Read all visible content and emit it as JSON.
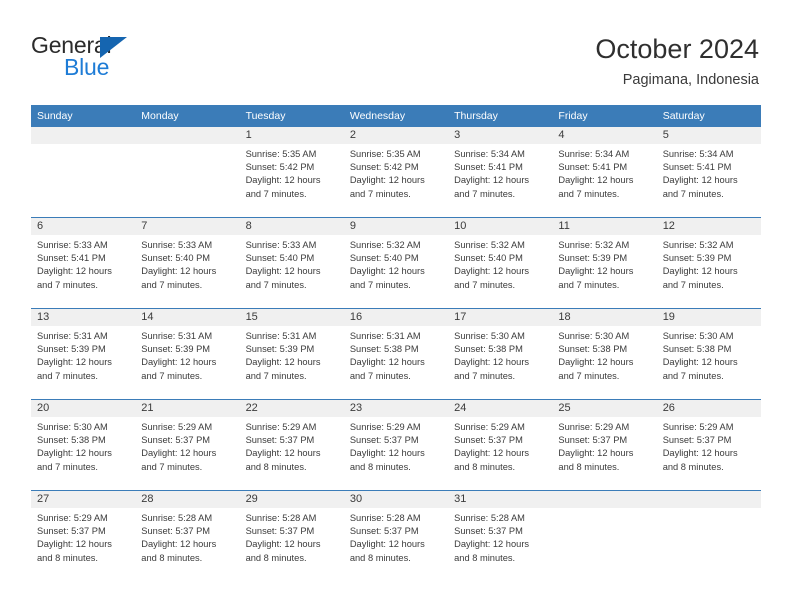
{
  "brand": {
    "name_top": "General",
    "name_bottom": "Blue",
    "triangle_color": "#1565b0",
    "blue_color": "#1e7cd6"
  },
  "header": {
    "title": "October 2024",
    "subtitle": "Pagimana, Indonesia"
  },
  "theme": {
    "header_bar": "#3b7cb8",
    "date_strip": "#f0f0f0",
    "text": "#3b3b3b"
  },
  "weekday_headers": [
    "Sunday",
    "Monday",
    "Tuesday",
    "Wednesday",
    "Thursday",
    "Friday",
    "Saturday"
  ],
  "weeks": [
    [
      {
        "day": "",
        "sunrise": "",
        "sunset": "",
        "daylight": ""
      },
      {
        "day": "",
        "sunrise": "",
        "sunset": "",
        "daylight": ""
      },
      {
        "day": "1",
        "sunrise": "Sunrise: 5:35 AM",
        "sunset": "Sunset: 5:42 PM",
        "daylight": "Daylight: 12 hours and 7 minutes."
      },
      {
        "day": "2",
        "sunrise": "Sunrise: 5:35 AM",
        "sunset": "Sunset: 5:42 PM",
        "daylight": "Daylight: 12 hours and 7 minutes."
      },
      {
        "day": "3",
        "sunrise": "Sunrise: 5:34 AM",
        "sunset": "Sunset: 5:41 PM",
        "daylight": "Daylight: 12 hours and 7 minutes."
      },
      {
        "day": "4",
        "sunrise": "Sunrise: 5:34 AM",
        "sunset": "Sunset: 5:41 PM",
        "daylight": "Daylight: 12 hours and 7 minutes."
      },
      {
        "day": "5",
        "sunrise": "Sunrise: 5:34 AM",
        "sunset": "Sunset: 5:41 PM",
        "daylight": "Daylight: 12 hours and 7 minutes."
      }
    ],
    [
      {
        "day": "6",
        "sunrise": "Sunrise: 5:33 AM",
        "sunset": "Sunset: 5:41 PM",
        "daylight": "Daylight: 12 hours and 7 minutes."
      },
      {
        "day": "7",
        "sunrise": "Sunrise: 5:33 AM",
        "sunset": "Sunset: 5:40 PM",
        "daylight": "Daylight: 12 hours and 7 minutes."
      },
      {
        "day": "8",
        "sunrise": "Sunrise: 5:33 AM",
        "sunset": "Sunset: 5:40 PM",
        "daylight": "Daylight: 12 hours and 7 minutes."
      },
      {
        "day": "9",
        "sunrise": "Sunrise: 5:32 AM",
        "sunset": "Sunset: 5:40 PM",
        "daylight": "Daylight: 12 hours and 7 minutes."
      },
      {
        "day": "10",
        "sunrise": "Sunrise: 5:32 AM",
        "sunset": "Sunset: 5:40 PM",
        "daylight": "Daylight: 12 hours and 7 minutes."
      },
      {
        "day": "11",
        "sunrise": "Sunrise: 5:32 AM",
        "sunset": "Sunset: 5:39 PM",
        "daylight": "Daylight: 12 hours and 7 minutes."
      },
      {
        "day": "12",
        "sunrise": "Sunrise: 5:32 AM",
        "sunset": "Sunset: 5:39 PM",
        "daylight": "Daylight: 12 hours and 7 minutes."
      }
    ],
    [
      {
        "day": "13",
        "sunrise": "Sunrise: 5:31 AM",
        "sunset": "Sunset: 5:39 PM",
        "daylight": "Daylight: 12 hours and 7 minutes."
      },
      {
        "day": "14",
        "sunrise": "Sunrise: 5:31 AM",
        "sunset": "Sunset: 5:39 PM",
        "daylight": "Daylight: 12 hours and 7 minutes."
      },
      {
        "day": "15",
        "sunrise": "Sunrise: 5:31 AM",
        "sunset": "Sunset: 5:39 PM",
        "daylight": "Daylight: 12 hours and 7 minutes."
      },
      {
        "day": "16",
        "sunrise": "Sunrise: 5:31 AM",
        "sunset": "Sunset: 5:38 PM",
        "daylight": "Daylight: 12 hours and 7 minutes."
      },
      {
        "day": "17",
        "sunrise": "Sunrise: 5:30 AM",
        "sunset": "Sunset: 5:38 PM",
        "daylight": "Daylight: 12 hours and 7 minutes."
      },
      {
        "day": "18",
        "sunrise": "Sunrise: 5:30 AM",
        "sunset": "Sunset: 5:38 PM",
        "daylight": "Daylight: 12 hours and 7 minutes."
      },
      {
        "day": "19",
        "sunrise": "Sunrise: 5:30 AM",
        "sunset": "Sunset: 5:38 PM",
        "daylight": "Daylight: 12 hours and 7 minutes."
      }
    ],
    [
      {
        "day": "20",
        "sunrise": "Sunrise: 5:30 AM",
        "sunset": "Sunset: 5:38 PM",
        "daylight": "Daylight: 12 hours and 7 minutes."
      },
      {
        "day": "21",
        "sunrise": "Sunrise: 5:29 AM",
        "sunset": "Sunset: 5:37 PM",
        "daylight": "Daylight: 12 hours and 7 minutes."
      },
      {
        "day": "22",
        "sunrise": "Sunrise: 5:29 AM",
        "sunset": "Sunset: 5:37 PM",
        "daylight": "Daylight: 12 hours and 8 minutes."
      },
      {
        "day": "23",
        "sunrise": "Sunrise: 5:29 AM",
        "sunset": "Sunset: 5:37 PM",
        "daylight": "Daylight: 12 hours and 8 minutes."
      },
      {
        "day": "24",
        "sunrise": "Sunrise: 5:29 AM",
        "sunset": "Sunset: 5:37 PM",
        "daylight": "Daylight: 12 hours and 8 minutes."
      },
      {
        "day": "25",
        "sunrise": "Sunrise: 5:29 AM",
        "sunset": "Sunset: 5:37 PM",
        "daylight": "Daylight: 12 hours and 8 minutes."
      },
      {
        "day": "26",
        "sunrise": "Sunrise: 5:29 AM",
        "sunset": "Sunset: 5:37 PM",
        "daylight": "Daylight: 12 hours and 8 minutes."
      }
    ],
    [
      {
        "day": "27",
        "sunrise": "Sunrise: 5:29 AM",
        "sunset": "Sunset: 5:37 PM",
        "daylight": "Daylight: 12 hours and 8 minutes."
      },
      {
        "day": "28",
        "sunrise": "Sunrise: 5:28 AM",
        "sunset": "Sunset: 5:37 PM",
        "daylight": "Daylight: 12 hours and 8 minutes."
      },
      {
        "day": "29",
        "sunrise": "Sunrise: 5:28 AM",
        "sunset": "Sunset: 5:37 PM",
        "daylight": "Daylight: 12 hours and 8 minutes."
      },
      {
        "day": "30",
        "sunrise": "Sunrise: 5:28 AM",
        "sunset": "Sunset: 5:37 PM",
        "daylight": "Daylight: 12 hours and 8 minutes."
      },
      {
        "day": "31",
        "sunrise": "Sunrise: 5:28 AM",
        "sunset": "Sunset: 5:37 PM",
        "daylight": "Daylight: 12 hours and 8 minutes."
      },
      {
        "day": "",
        "sunrise": "",
        "sunset": "",
        "daylight": ""
      },
      {
        "day": "",
        "sunrise": "",
        "sunset": "",
        "daylight": ""
      }
    ]
  ]
}
